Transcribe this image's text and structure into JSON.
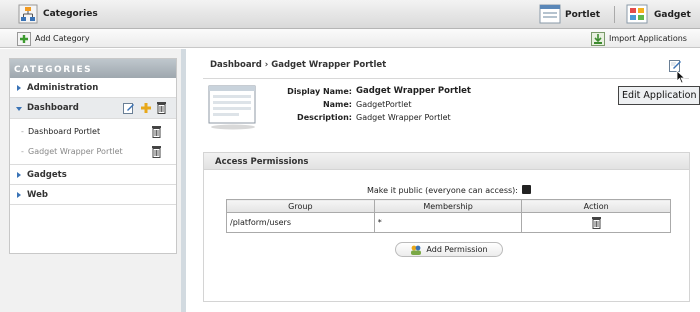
{
  "topbar": {
    "title": "Categories",
    "portlet_label": "Portlet",
    "gadget_label": "Gadget"
  },
  "actionbar": {
    "add_category": "Add Category",
    "import_applications": "Import Applications"
  },
  "sidebar": {
    "header": "CATEGORIES",
    "categories": [
      {
        "label": "Administration",
        "expanded": false
      },
      {
        "label": "Dashboard",
        "expanded": true,
        "items": [
          "Dashboard Portlet",
          "Gadget Wrapper Portlet"
        ]
      },
      {
        "label": "Gadgets",
        "expanded": false
      },
      {
        "label": "Web",
        "expanded": false
      }
    ]
  },
  "main": {
    "breadcrumb": "Dashboard  ›  Gadget Wrapper Portlet",
    "tooltip": "Edit Application",
    "info": {
      "display_name_key": "Display Name:",
      "display_name_val": "Gadget Wrapper Portlet",
      "name_key": "Name:",
      "name_val": "GadgetPortlet",
      "description_key": "Description:",
      "description_val": "Gadget Wrapper Portlet"
    },
    "permissions": {
      "title": "Access Permissions",
      "public_label": "Make it public (everyone can access):",
      "columns": [
        "Group",
        "Membership",
        "Action"
      ],
      "rows": [
        {
          "group": "/platform/users",
          "membership": "*"
        }
      ],
      "add_button": "Add Permission"
    }
  },
  "colors": {
    "accent_blue": "#3a73b6",
    "category_header": "#a9b1b7",
    "panel_border": "#d2dae0"
  }
}
